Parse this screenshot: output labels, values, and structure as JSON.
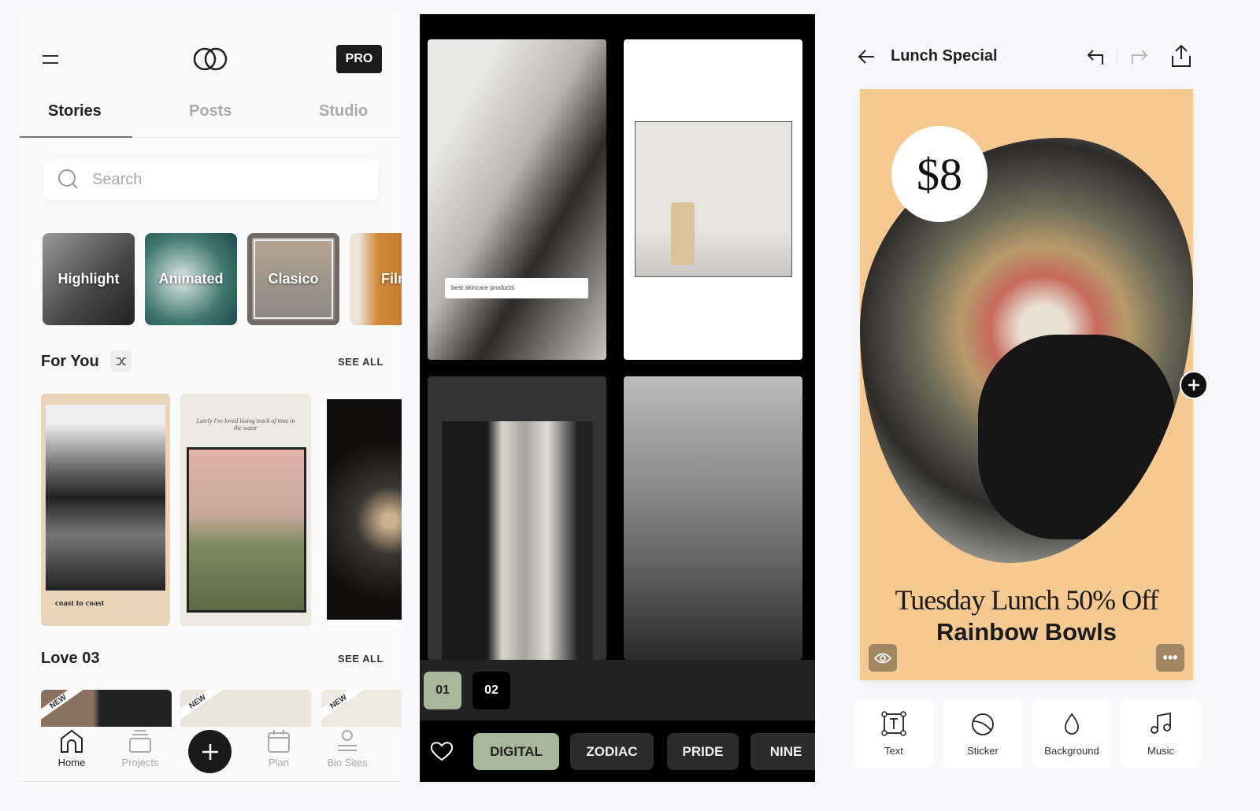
{
  "left": {
    "pro_badge": "PRO",
    "tabs": [
      {
        "label": "Stories",
        "active": true
      },
      {
        "label": "Posts"
      },
      {
        "label": "Studio"
      }
    ],
    "search": {
      "placeholder": "Search"
    },
    "categories": [
      "Highlight",
      "Animated",
      "Clasico",
      "Film"
    ],
    "for_you": {
      "title": "For You",
      "see_all": "SEE ALL",
      "cards": [
        {
          "caption": "coast to coast"
        },
        {
          "caption": "Lately I've loved losing track of time in the water"
        },
        {
          "caption": ""
        }
      ]
    },
    "love": {
      "title": "Love 03",
      "see_all": "SEE ALL",
      "badge": "NEW"
    },
    "nav": [
      {
        "label": "Home",
        "icon": "home-icon",
        "active": true
      },
      {
        "label": "Projects",
        "icon": "stack-icon"
      },
      {
        "label": "Plan",
        "icon": "calendar-icon"
      },
      {
        "label": "Bio Sites",
        "icon": "person-icon"
      }
    ]
  },
  "middle": {
    "search_text": "best skincare products",
    "pages": [
      "01",
      "02"
    ],
    "chips": [
      "DIGITAL",
      "ZODIAC",
      "PRIDE",
      "NINE"
    ],
    "accent": "#a7b79c"
  },
  "right": {
    "title": "Lunch Special",
    "price": "$8",
    "headline": "Tuesday Lunch 50% Off",
    "subhead": "Rainbow Bowls",
    "canvas_color": "#f5c990",
    "tools": [
      {
        "label": "Text",
        "icon": "text-box-icon"
      },
      {
        "label": "Sticker",
        "icon": "sticker-icon"
      },
      {
        "label": "Background",
        "icon": "drop-icon"
      },
      {
        "label": "Music",
        "icon": "music-icon"
      }
    ]
  }
}
